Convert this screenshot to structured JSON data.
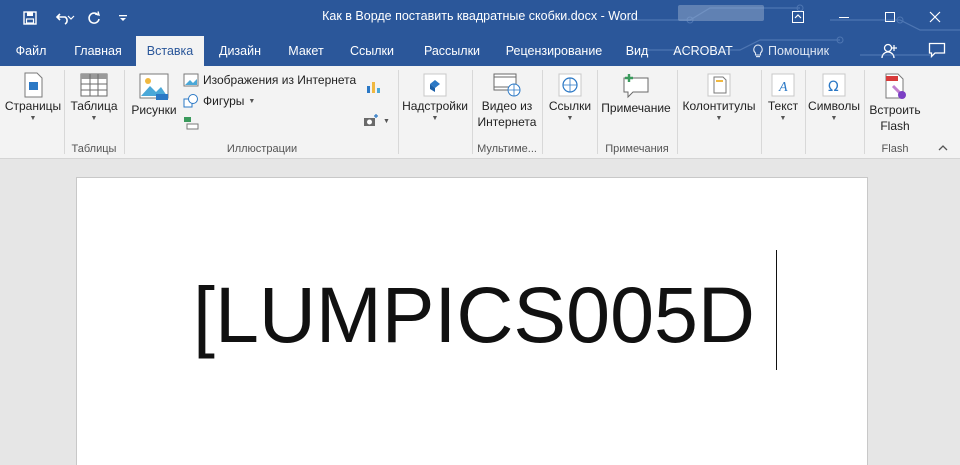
{
  "window": {
    "title": "Как в Ворде поставить квадратные скобки.docx - Word"
  },
  "tabs": [
    {
      "label": "Файл",
      "active": false
    },
    {
      "label": "Главная",
      "active": false
    },
    {
      "label": "Вставка",
      "active": true
    },
    {
      "label": "Дизайн",
      "active": false
    },
    {
      "label": "Макет",
      "active": false
    },
    {
      "label": "Ссылки",
      "active": false
    },
    {
      "label": "Рассылки",
      "active": false
    },
    {
      "label": "Рецензирование",
      "active": false
    },
    {
      "label": "Вид",
      "active": false
    },
    {
      "label": "ACROBAT",
      "active": false
    }
  ],
  "tell_me": "Помощник",
  "ribbon": {
    "pages": "Страницы",
    "table": "Таблица",
    "pictures": "Рисунки",
    "online_pictures": "Изображения из Интернета",
    "shapes": "Фигуры",
    "addins": "Надстройки",
    "online_video": [
      "Видео из",
      "Интернета"
    ],
    "links": "Ссылки",
    "comment": "Примечание",
    "header_footer": "Колонтитулы",
    "text": "Текст",
    "symbols": "Символы",
    "embed_flash": [
      "Встроить",
      "Flash"
    ]
  },
  "groups": {
    "tables": "Таблицы",
    "illustrations": "Иллюстрации",
    "media": "Мультиме...",
    "comments": "Примечания",
    "flash": "Flash"
  },
  "document": {
    "text": "[LUMPICS005D"
  },
  "colors": {
    "accent": "#2b579a",
    "ribbon_bg": "#f3f3f3"
  }
}
